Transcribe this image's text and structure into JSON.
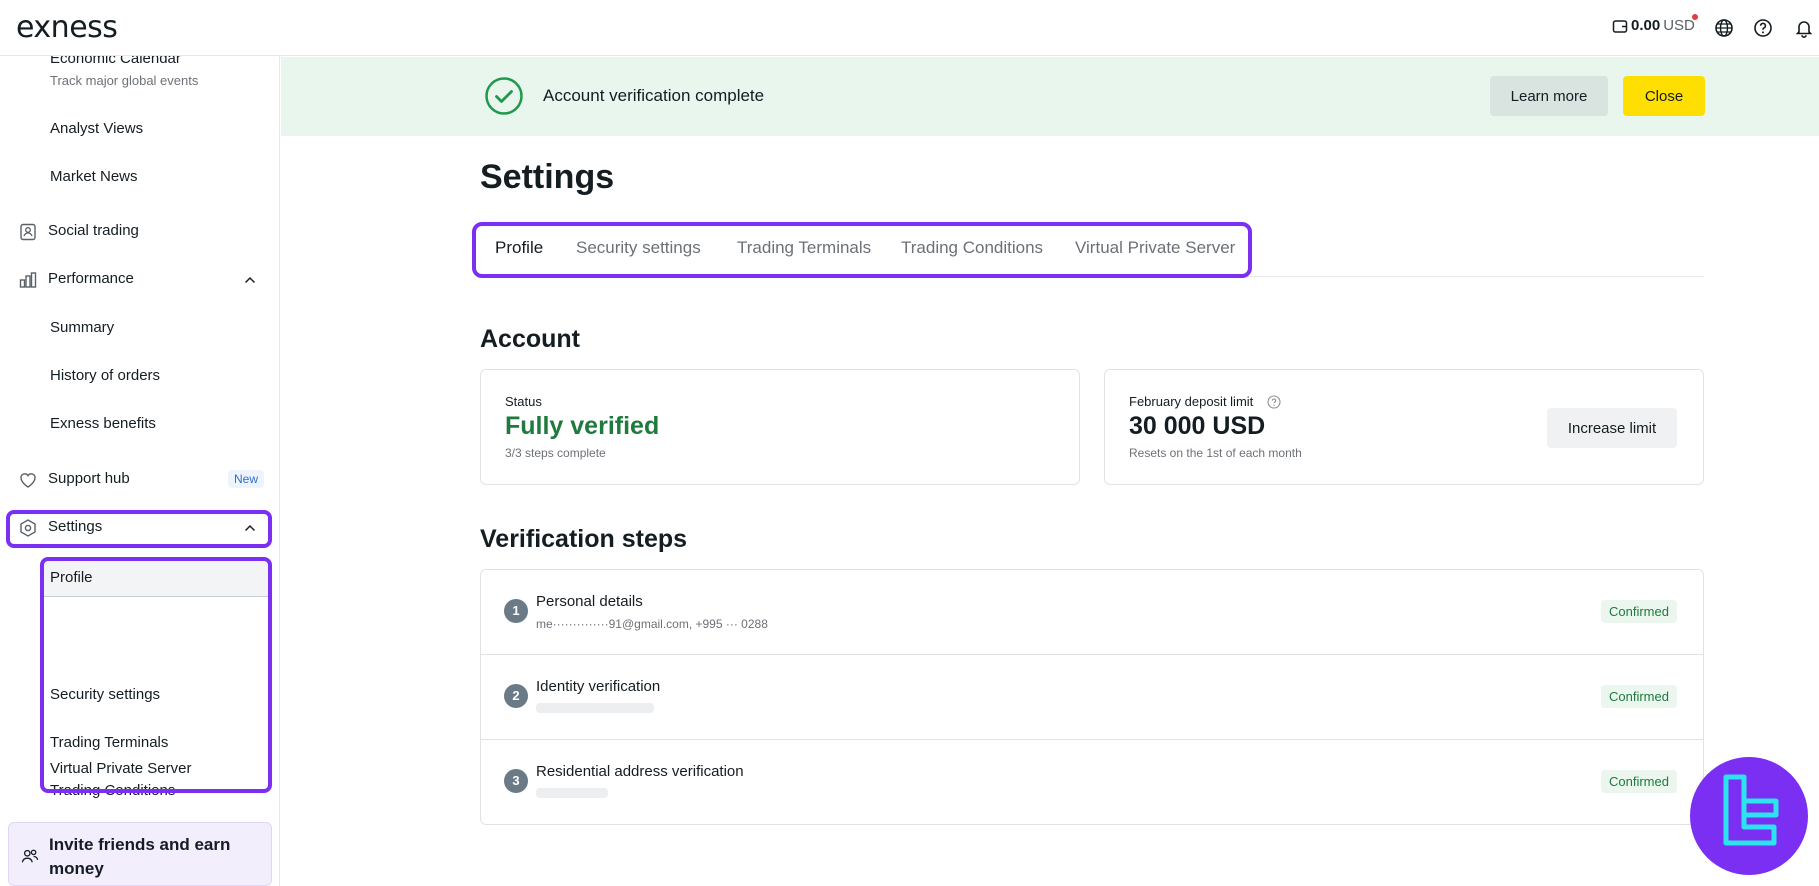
{
  "header": {
    "logo": "exness",
    "balance_amount": "0.00",
    "balance_currency": "USD",
    "icons": [
      "wallet-icon",
      "globe-icon",
      "help-icon",
      "bell-icon"
    ]
  },
  "sidebar": {
    "items": [
      {
        "label": "Economic Calendar",
        "caption": "Track major global events"
      },
      {
        "label": "Analyst Views"
      },
      {
        "label": "Market News"
      },
      {
        "label": "Social trading",
        "icon": "social-trading-icon"
      },
      {
        "label": "Performance",
        "icon": "bar-chart-icon"
      },
      {
        "label": "Summary"
      },
      {
        "label": "History of orders"
      },
      {
        "label": "Exness benefits"
      },
      {
        "label": "Support hub",
        "icon": "heart-icon",
        "badge": "New"
      },
      {
        "label": "Settings",
        "icon": "hexagon-gear-icon"
      },
      {
        "label": "Profile"
      },
      {
        "label": "Security settings"
      },
      {
        "label": "Trading Terminals"
      },
      {
        "label": "Trading Conditions"
      },
      {
        "label": "Virtual Private Server"
      }
    ],
    "invite": "Invite friends and earn money"
  },
  "banner": {
    "text": "Account verification complete",
    "learn_more": "Learn more",
    "close": "Close"
  },
  "main": {
    "title": "Settings",
    "tabs": [
      {
        "label": "Profile",
        "active": true
      },
      {
        "label": "Security settings"
      },
      {
        "label": "Trading Terminals"
      },
      {
        "label": "Trading Conditions"
      },
      {
        "label": "Virtual Private Server"
      }
    ],
    "account_heading": "Account",
    "status_card": {
      "label": "Status",
      "value": "Fully verified",
      "sub": "3/3 steps complete"
    },
    "limit_card": {
      "label": "February deposit limit",
      "value": "30 000 USD",
      "sub": "Resets on the 1st of each month",
      "button": "Increase limit"
    },
    "verification_heading": "Verification steps",
    "steps": [
      {
        "num": "1",
        "title": "Personal details",
        "detail": "me··············91@gmail.com, +995 ··· 0288",
        "status": "Confirmed"
      },
      {
        "num": "2",
        "title": "Identity verification",
        "detail": "",
        "status": "Confirmed"
      },
      {
        "num": "3",
        "title": "Residential address verification",
        "detail": "",
        "status": "Confirmed"
      }
    ]
  },
  "colors": {
    "accent_highlight": "#7b2ff2",
    "close_button": "#ffde02",
    "banner_bg": "#e8f6ee",
    "verified_green": "#1f7a3e"
  }
}
